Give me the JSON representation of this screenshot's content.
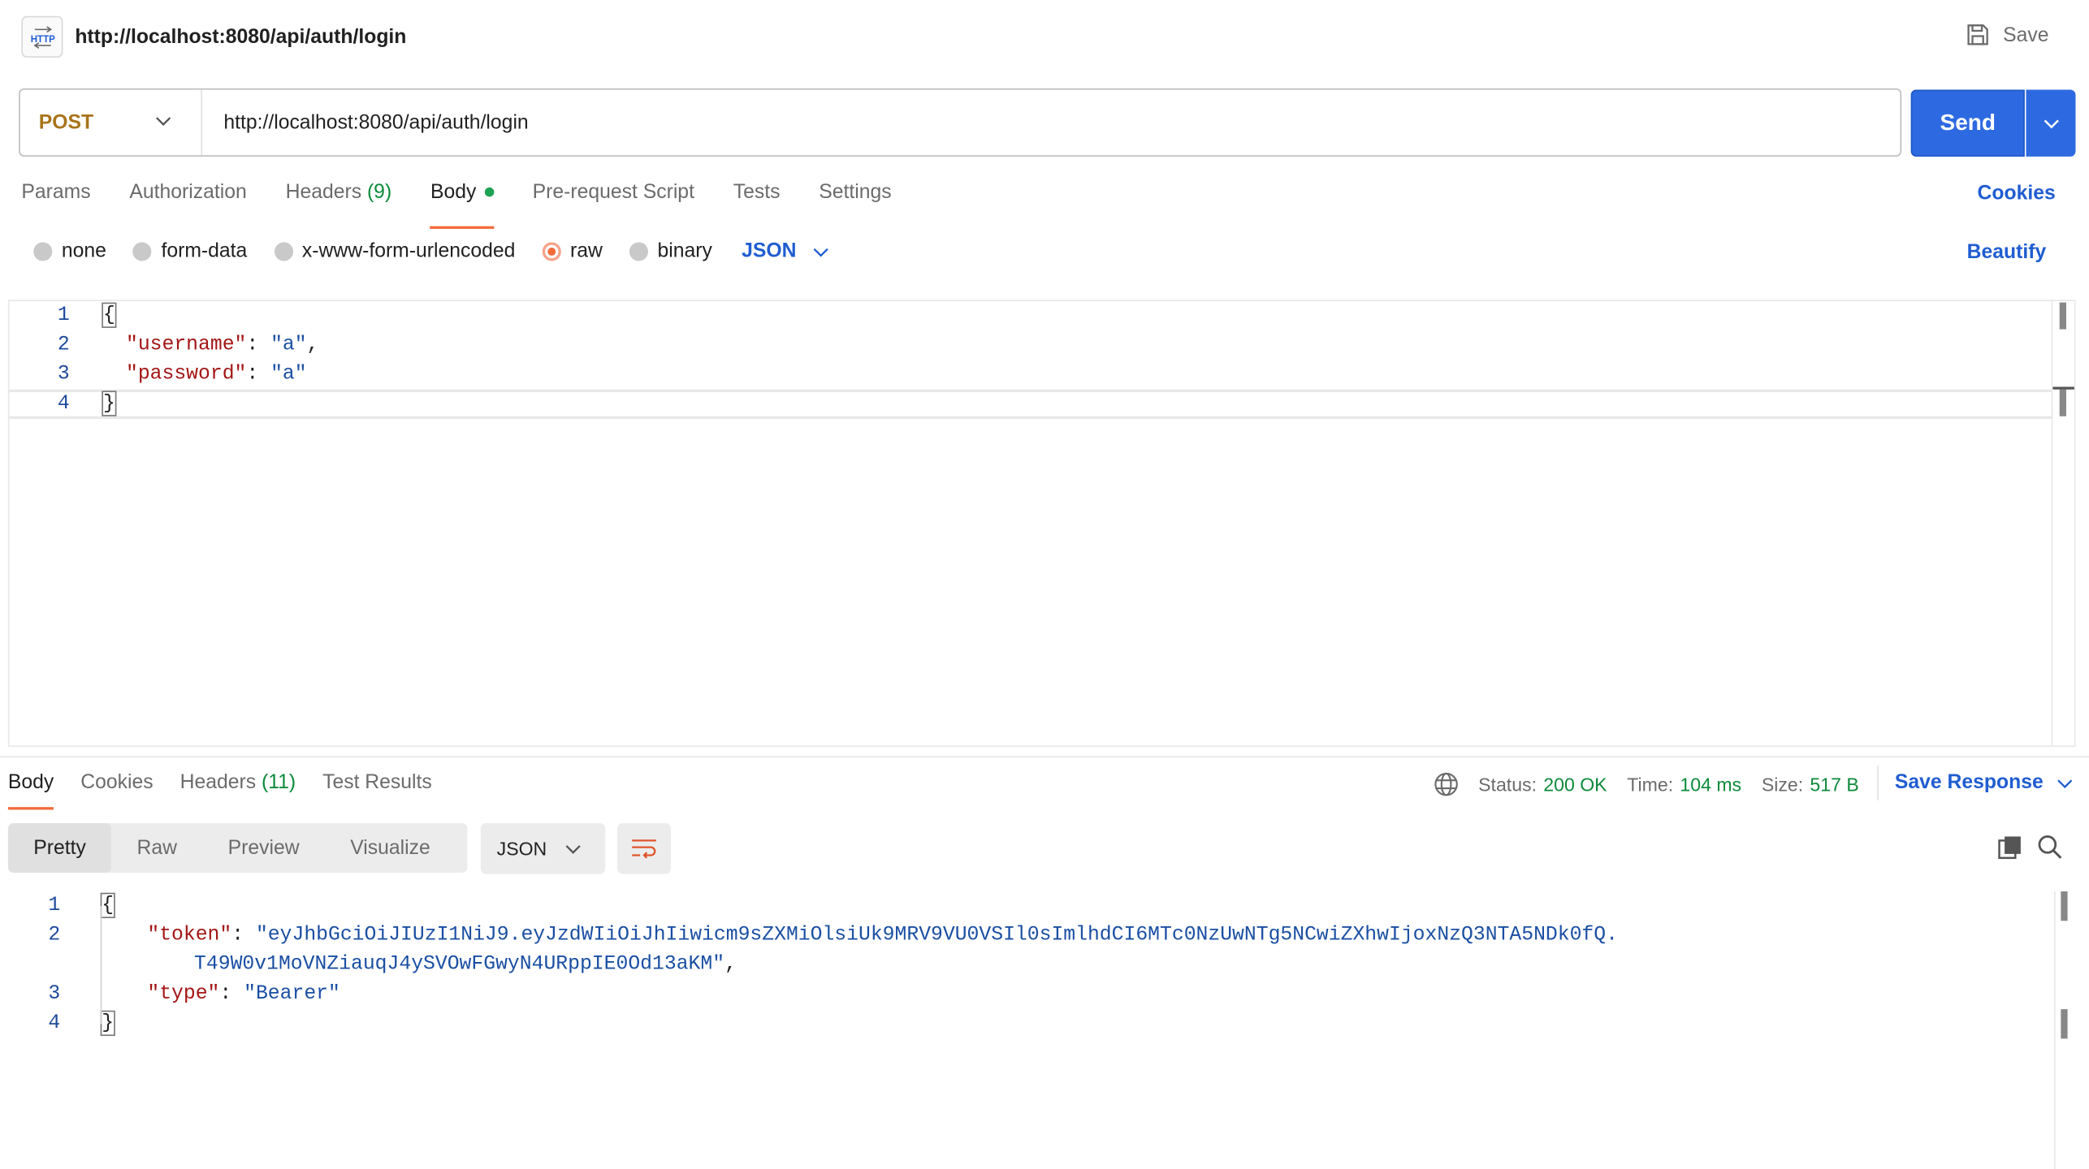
{
  "header": {
    "title": "http://localhost:8080/api/auth/login",
    "save_label": "Save"
  },
  "request": {
    "method": "POST",
    "url": "http://localhost:8080/api/auth/login",
    "send_label": "Send"
  },
  "request_tabs": {
    "params": "Params",
    "authorization": "Authorization",
    "headers": "Headers",
    "headers_count": "(9)",
    "body": "Body",
    "prerequest": "Pre-request Script",
    "tests": "Tests",
    "settings": "Settings",
    "cookies": "Cookies"
  },
  "body_types": {
    "none": "none",
    "form_data": "form-data",
    "urlencoded": "x-www-form-urlencoded",
    "raw": "raw",
    "binary": "binary",
    "language": "JSON",
    "beautify": "Beautify",
    "selected": "raw"
  },
  "request_body": {
    "lines": [
      {
        "n": "1",
        "text": "{"
      },
      {
        "n": "2",
        "key": "\"username\"",
        "val": "\"a\"",
        "tail": ","
      },
      {
        "n": "3",
        "key": "\"password\"",
        "val": "\"a\"",
        "tail": ""
      },
      {
        "n": "4",
        "text": "}"
      }
    ]
  },
  "response_tabs": {
    "body": "Body",
    "cookies": "Cookies",
    "headers": "Headers",
    "headers_count": "(11)",
    "test_results": "Test Results"
  },
  "response_meta": {
    "status_label": "Status:",
    "status_value": "200 OK",
    "time_label": "Time:",
    "time_value": "104 ms",
    "size_label": "Size:",
    "size_value": "517 B",
    "save_response": "Save Response"
  },
  "response_view": {
    "pretty": "Pretty",
    "raw": "Raw",
    "preview": "Preview",
    "visualize": "Visualize",
    "format": "JSON"
  },
  "response_body": {
    "l1": "{",
    "token_key": "\"token\"",
    "token_val_1": "\"eyJhbGciOiJIUzI1NiJ9.eyJzdWIiOiJhIiwicm9sZXMiOlsiUk9MRV9VU0VSIl0sImlhdCI6MTc0NzUwNTg5NCwiZXhwIjoxNzQ3NTA5NDk0fQ.",
    "token_val_2": "T49W0v1MoVNZiauqJ4ySVOwFGwyN4URppIE0Od13aKM\"",
    "type_key": "\"type\"",
    "type_val": "\"Bearer\"",
    "l4": "}",
    "line_numbers": [
      "1",
      "2",
      "3",
      "4"
    ]
  },
  "colors": {
    "accent": "#2d6ae2",
    "tab_underline": "#f26b3a",
    "status_ok": "#0c8a3a",
    "method": "#a8741a"
  }
}
